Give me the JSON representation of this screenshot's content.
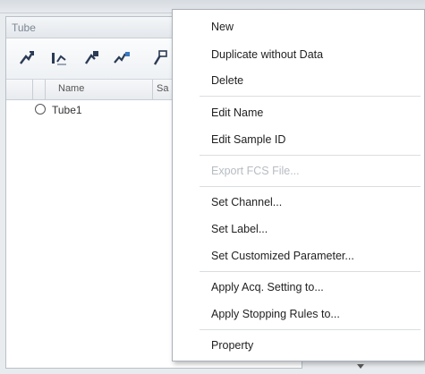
{
  "panel": {
    "title": "Tube",
    "toolbar": [
      {
        "icon": "new-tube-icon"
      },
      {
        "icon": "tube-settings-icon"
      },
      {
        "icon": "duplicate-tube-icon"
      },
      {
        "icon": "tube-parameter-icon"
      },
      {
        "icon": "tube-tool-icon"
      }
    ],
    "columns": [
      {
        "label": ""
      },
      {
        "label": "Name"
      },
      {
        "label": "Sa"
      }
    ],
    "rows": [
      {
        "name": "Tube1"
      }
    ]
  },
  "context_menu": {
    "items": [
      {
        "label": "New",
        "enabled": true
      },
      {
        "label": "Duplicate without Data",
        "enabled": true
      },
      {
        "label": "Delete",
        "enabled": true
      },
      {
        "label": "Edit Name",
        "enabled": true
      },
      {
        "label": "Edit Sample ID",
        "enabled": true
      },
      {
        "label": "Export FCS File...",
        "enabled": false
      },
      {
        "label": "Set Channel...",
        "enabled": true
      },
      {
        "label": "Set Label...",
        "enabled": true
      },
      {
        "label": "Set Customized Parameter...",
        "enabled": true
      },
      {
        "label": "Apply Acq. Setting to...",
        "enabled": true
      },
      {
        "label": "Apply Stopping Rules to...",
        "enabled": true
      },
      {
        "label": "Property",
        "enabled": true
      }
    ]
  }
}
